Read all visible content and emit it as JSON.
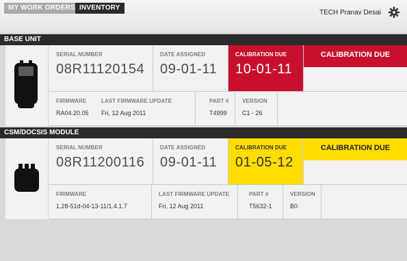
{
  "tabs": {
    "my_work_orders": "MY WORK ORDERS",
    "inventory": "INVENTORY"
  },
  "user": {
    "tech_label": "TECH Pranav Desai"
  },
  "sections": [
    {
      "title": "BASE UNIT",
      "serial_label": "SERIAL NUMBER",
      "serial": "08R11120154",
      "assigned_label": "DATE ASSIGNED",
      "assigned": "09-01-11",
      "cal_label": "CALIBRATION DUE",
      "cal_date": "10-01-11",
      "cal_status": "CALIBRATION DUE",
      "cal_color": "#c8102e",
      "firmware_label": "FIRMWARE",
      "firmware": "RA04.20.05",
      "last_update_label": "LAST FIRMWARE UPDATE",
      "last_update": "Fri, 12 Aug 2011",
      "part_label": "PART #",
      "part": "T4999",
      "version_label": "VERSION",
      "version": "C1 - 26"
    },
    {
      "title": "CSM/DOCSIS MODULE",
      "serial_label": "SERIAL NUMBER",
      "serial": "08R11200116",
      "assigned_label": "DATE ASSIGNED",
      "assigned": "09-01-11",
      "cal_label": "CALIBRATION DUE",
      "cal_date": "01-05-12",
      "cal_status": "CALIBRATION DUE",
      "cal_color": "#ffdd00",
      "firmware_label": "FIRMWARE",
      "firmware": "1.28-51d-04-13-11/1.4.1.7",
      "last_update_label": "LAST FIRMWARE UPDATE",
      "last_update": "Fri, 12 Aug 2011",
      "part_label": "PART #",
      "part": "T5632-1",
      "version_label": "VERSION",
      "version": "B0"
    }
  ]
}
